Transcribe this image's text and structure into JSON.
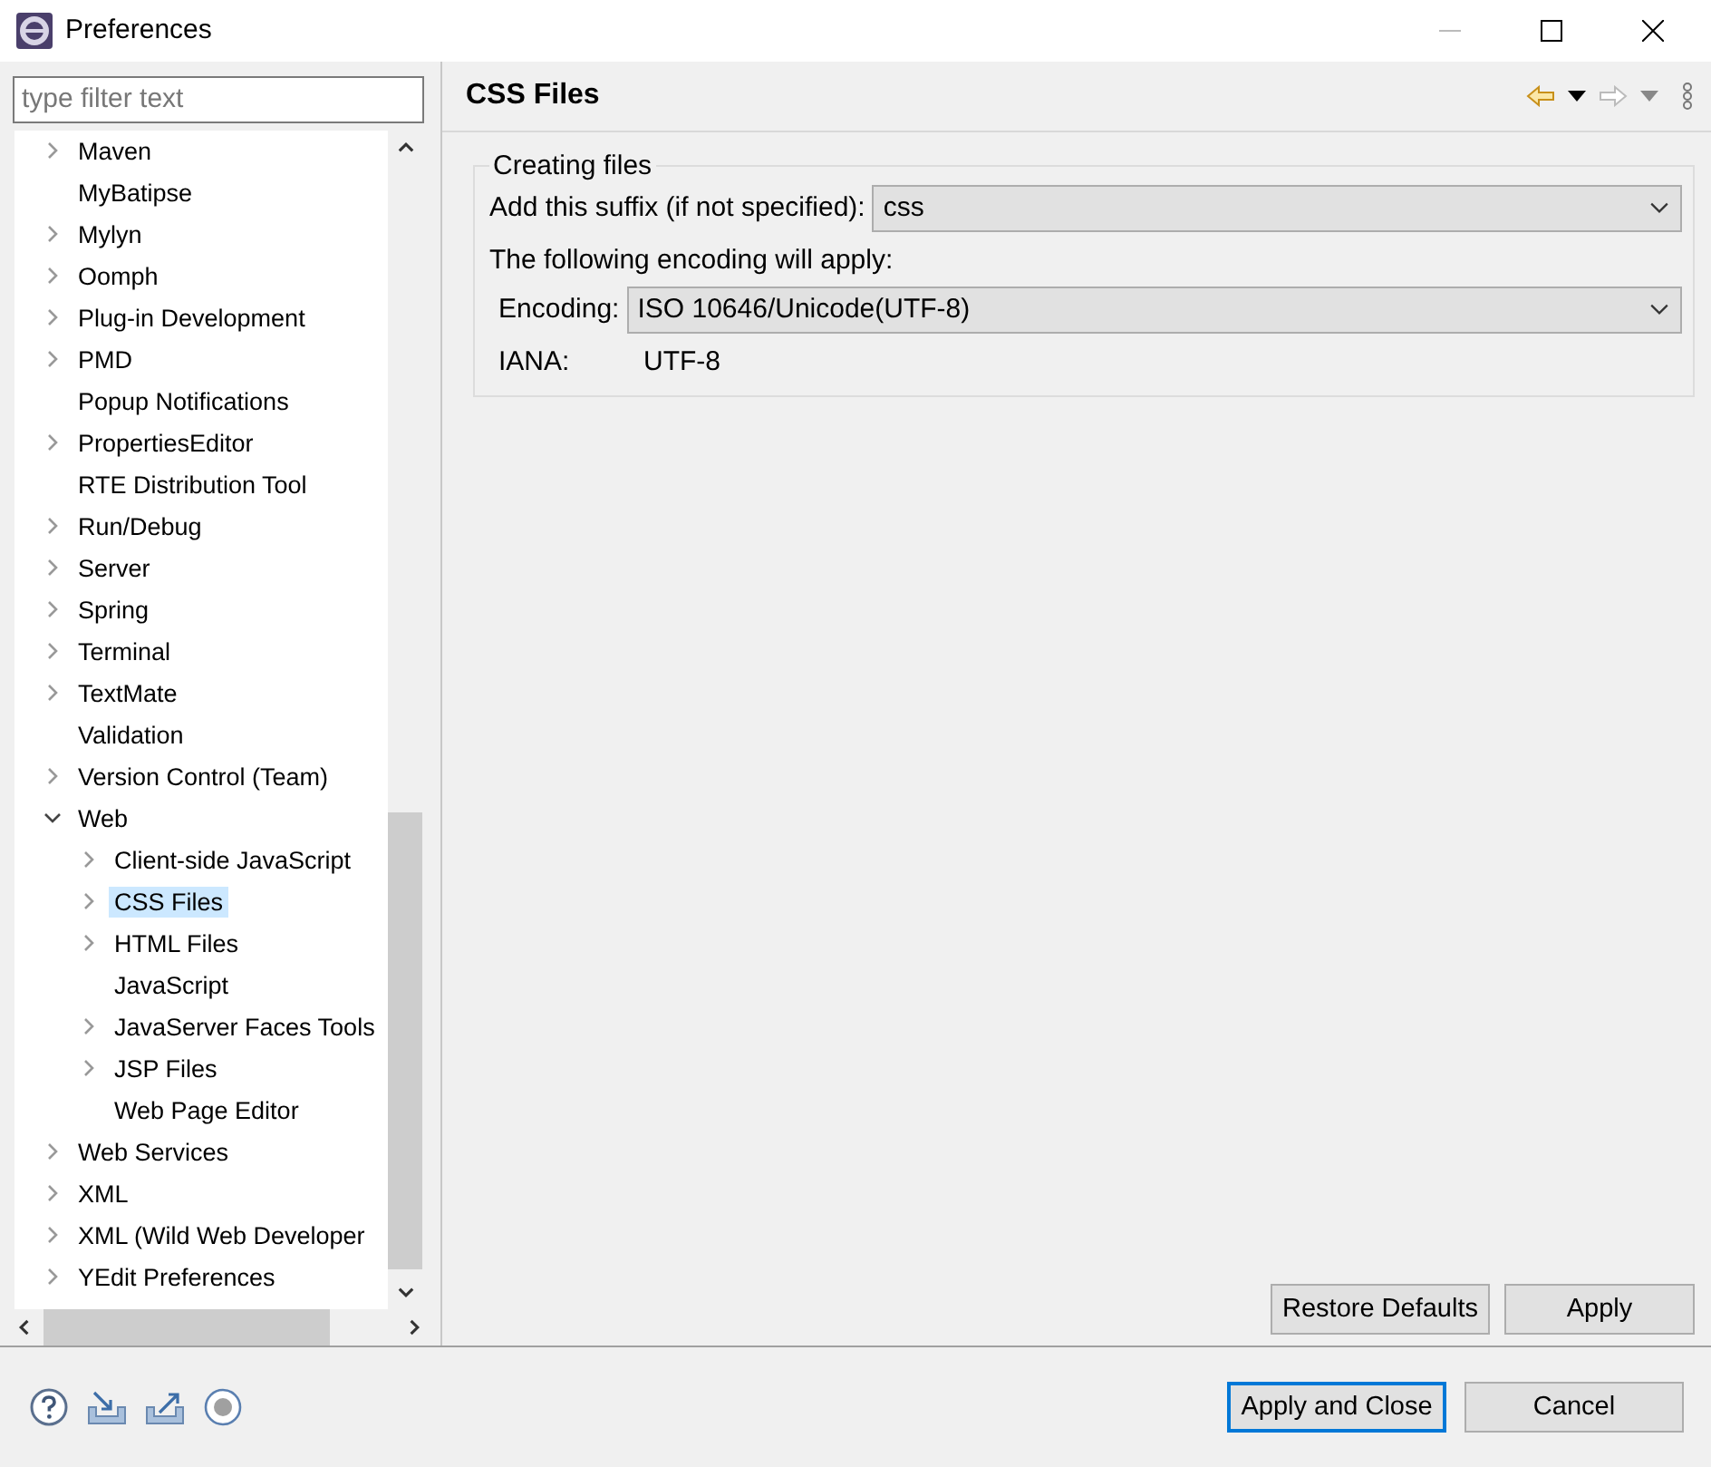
{
  "window": {
    "title": "Preferences"
  },
  "filter": {
    "placeholder": "type filter text"
  },
  "tree": [
    {
      "label": "Maven",
      "expanded": false,
      "selected": false
    },
    {
      "label": "MyBatipse",
      "selected": false
    },
    {
      "label": "Mylyn",
      "expanded": false,
      "selected": false
    },
    {
      "label": "Oomph",
      "expanded": false,
      "selected": false
    },
    {
      "label": "Plug-in Development",
      "expanded": false,
      "selected": false
    },
    {
      "label": "PMD",
      "expanded": false,
      "selected": false
    },
    {
      "label": "Popup Notifications",
      "selected": false
    },
    {
      "label": "PropertiesEditor",
      "expanded": false,
      "selected": false
    },
    {
      "label": "RTE Distribution Tool",
      "selected": false
    },
    {
      "label": "Run/Debug",
      "expanded": false,
      "selected": false
    },
    {
      "label": "Server",
      "expanded": false,
      "selected": false
    },
    {
      "label": "Spring",
      "expanded": false,
      "selected": false
    },
    {
      "label": "Terminal",
      "expanded": false,
      "selected": false
    },
    {
      "label": "TextMate",
      "expanded": false,
      "selected": false
    },
    {
      "label": "Validation",
      "selected": false
    },
    {
      "label": "Version Control (Team)",
      "expanded": false,
      "selected": false
    },
    {
      "label": "Web",
      "expanded": true,
      "selected": false,
      "children": [
        {
          "label": "Client-side JavaScript",
          "expanded": false,
          "selected": false
        },
        {
          "label": "CSS Files",
          "expanded": false,
          "selected": true
        },
        {
          "label": "HTML Files",
          "expanded": false,
          "selected": false
        },
        {
          "label": "JavaScript",
          "selected": false
        },
        {
          "label": "JavaServer Faces Tools",
          "expanded": false,
          "selected": false
        },
        {
          "label": "JSP Files",
          "expanded": false,
          "selected": false
        },
        {
          "label": "Web Page Editor",
          "selected": false
        }
      ]
    },
    {
      "label": "Web Services",
      "expanded": false,
      "selected": false
    },
    {
      "label": "XML",
      "expanded": false,
      "selected": false
    },
    {
      "label": "XML (Wild Web Developer",
      "expanded": false,
      "selected": false
    },
    {
      "label": "YEdit Preferences",
      "expanded": false,
      "selected": false
    }
  ],
  "page": {
    "title": "CSS Files",
    "group": {
      "title": "Creating files",
      "suffix_label": "Add this suffix (if not specified):",
      "suffix_value": "css",
      "encoding_note": "The following encoding will apply:",
      "encoding_label": "Encoding:",
      "encoding_value": "ISO 10646/Unicode(UTF-8)",
      "iana_label": "IANA:",
      "iana_value": "UTF-8"
    },
    "buttons": [
      "Restore Defaults",
      "Apply"
    ]
  },
  "footer_buttons": [
    {
      "label": "Apply and Close",
      "default": true
    },
    {
      "label": "Cancel",
      "default": false
    }
  ]
}
